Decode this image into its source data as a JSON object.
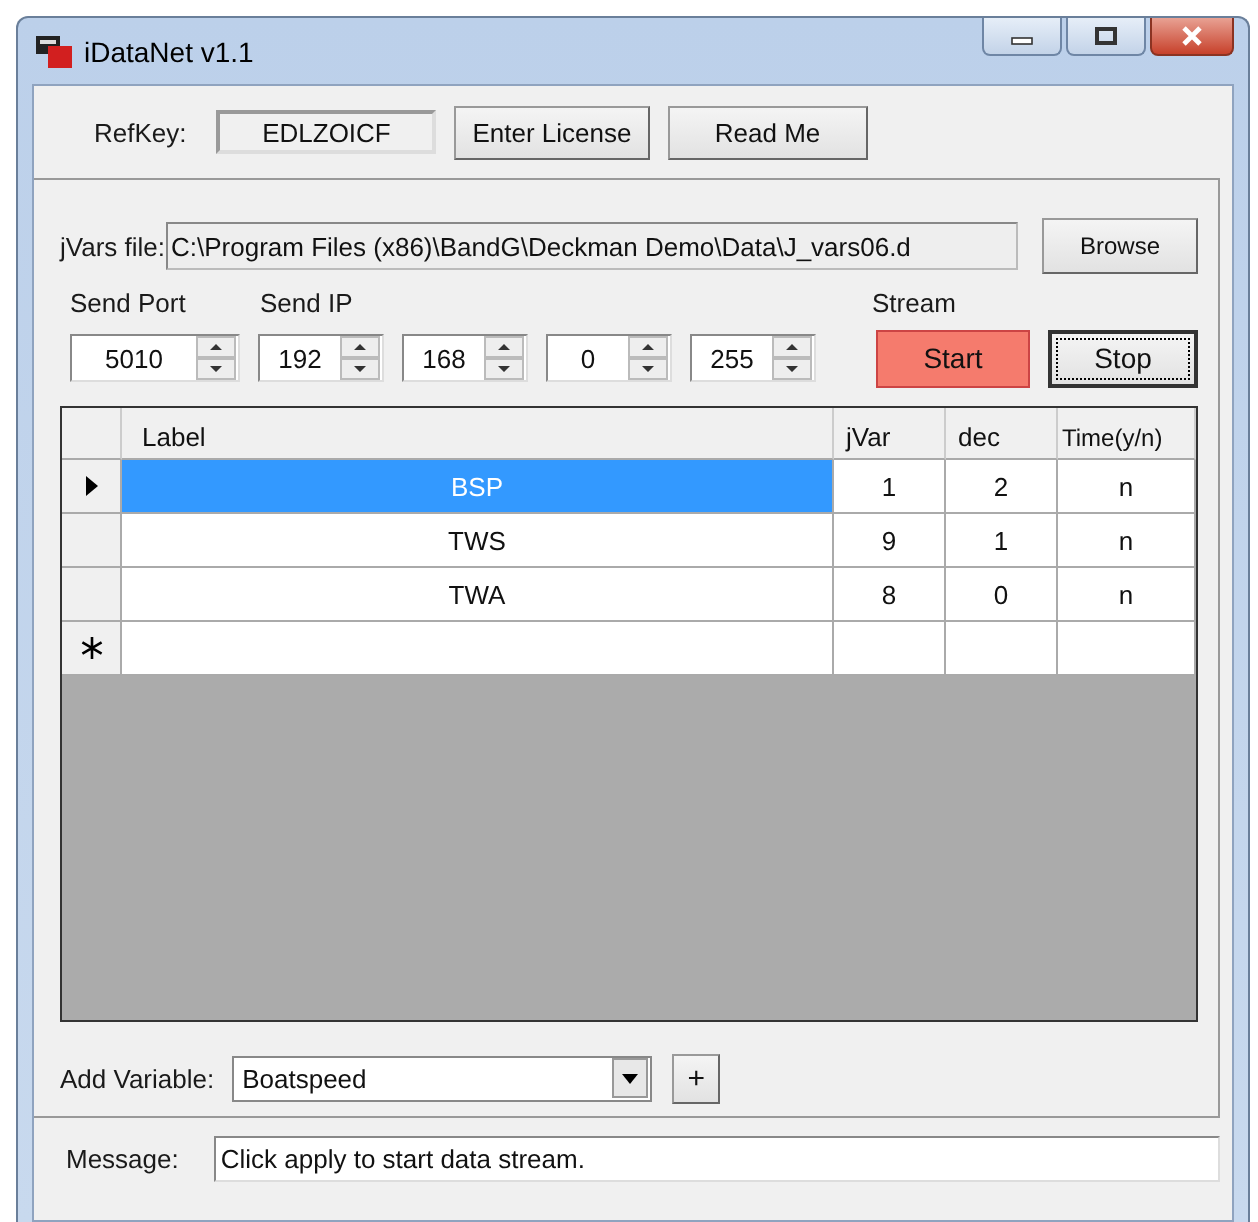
{
  "window": {
    "title": "iDataNet v1.1"
  },
  "refkey": {
    "label": "RefKey:",
    "value": "EDLZOICF"
  },
  "buttons": [
    "Enter License",
    "Read Me"
  ],
  "jvars": {
    "label": "jVars file:",
    "value": "C:\\Program Files (x86)\\BandG\\Deckman Demo\\Data\\J_vars06.d",
    "button": "Browse"
  },
  "send_port": {
    "label": "Send Port",
    "value": "5010"
  },
  "send_ip": {
    "label": "Send IP",
    "octets": [
      "192",
      "168",
      "0",
      "255"
    ]
  },
  "stream": {
    "label": "Stream",
    "start": "Start",
    "stop": "Stop"
  },
  "table": {
    "columns": [
      "Label",
      "jVar",
      "dec",
      "Time(y/n)"
    ],
    "rows": [
      {
        "cells": [
          "BSP",
          "1",
          "2",
          "n"
        ],
        "selected": true
      },
      {
        "cells": [
          "TWS",
          "9",
          "1",
          "n"
        ],
        "selected": false
      },
      {
        "cells": [
          "TWA",
          "8",
          "0",
          "n"
        ],
        "selected": false
      }
    ]
  },
  "add_variable": {
    "label": "Add Variable:",
    "value": "Boatspeed",
    "button": "+"
  },
  "message": {
    "label": "Message:",
    "value": "Click apply to start data stream."
  }
}
